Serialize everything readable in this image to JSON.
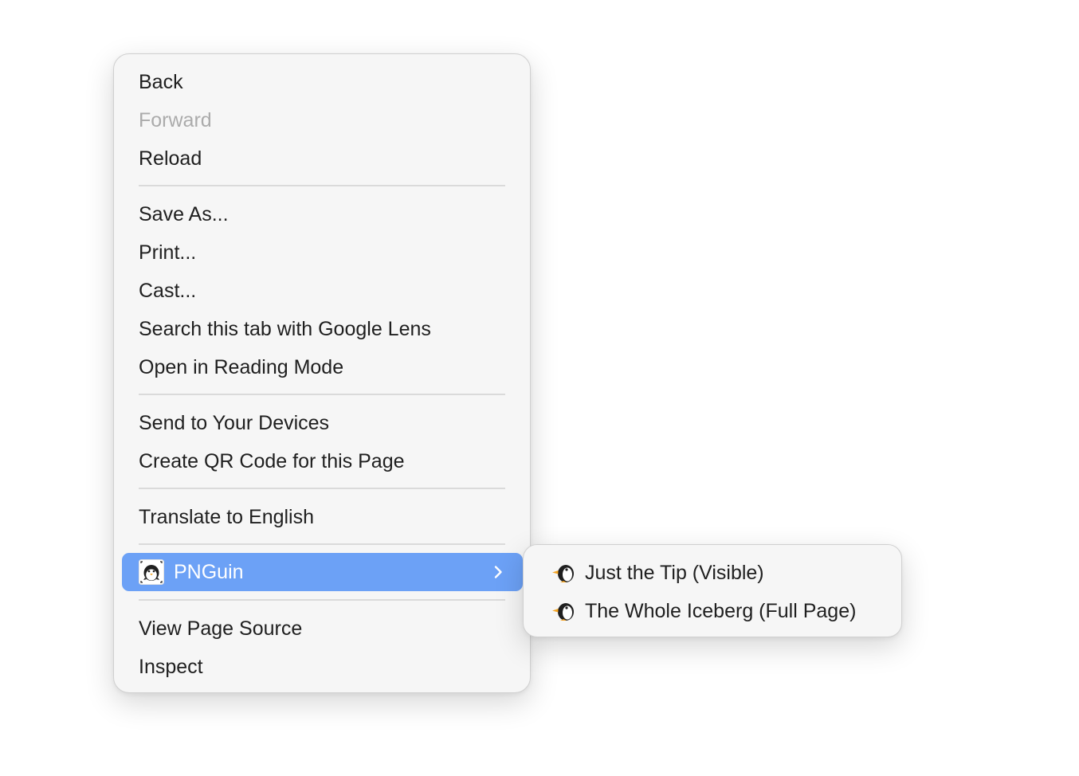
{
  "context_menu": {
    "items": {
      "back": "Back",
      "forward": "Forward",
      "reload": "Reload",
      "save_as": "Save As...",
      "print": "Print...",
      "cast": "Cast...",
      "search_lens": "Search this tab with Google Lens",
      "reading_mode": "Open in Reading Mode",
      "send_devices": "Send to Your Devices",
      "qr_code": "Create QR Code for this Page",
      "translate": "Translate to English",
      "pnguin": "PNGuin",
      "view_source": "View Page Source",
      "inspect": "Inspect"
    },
    "disabled": [
      "Forward"
    ],
    "highlighted": "PNGuin",
    "icons": {
      "pnguin": "pnguin-app-icon",
      "submenu_arrow": "chevron-right-icon"
    }
  },
  "submenu": {
    "items": {
      "visible": "Just the Tip (Visible)",
      "full_page": "The Whole Iceberg (Full Page)"
    },
    "icons": {
      "item": "penguin-icon"
    }
  },
  "colors": {
    "highlight": "#6ca1f6",
    "menu_background": "#f6f6f6",
    "disabled_text": "#ababab",
    "text": "#1f1f1f"
  }
}
